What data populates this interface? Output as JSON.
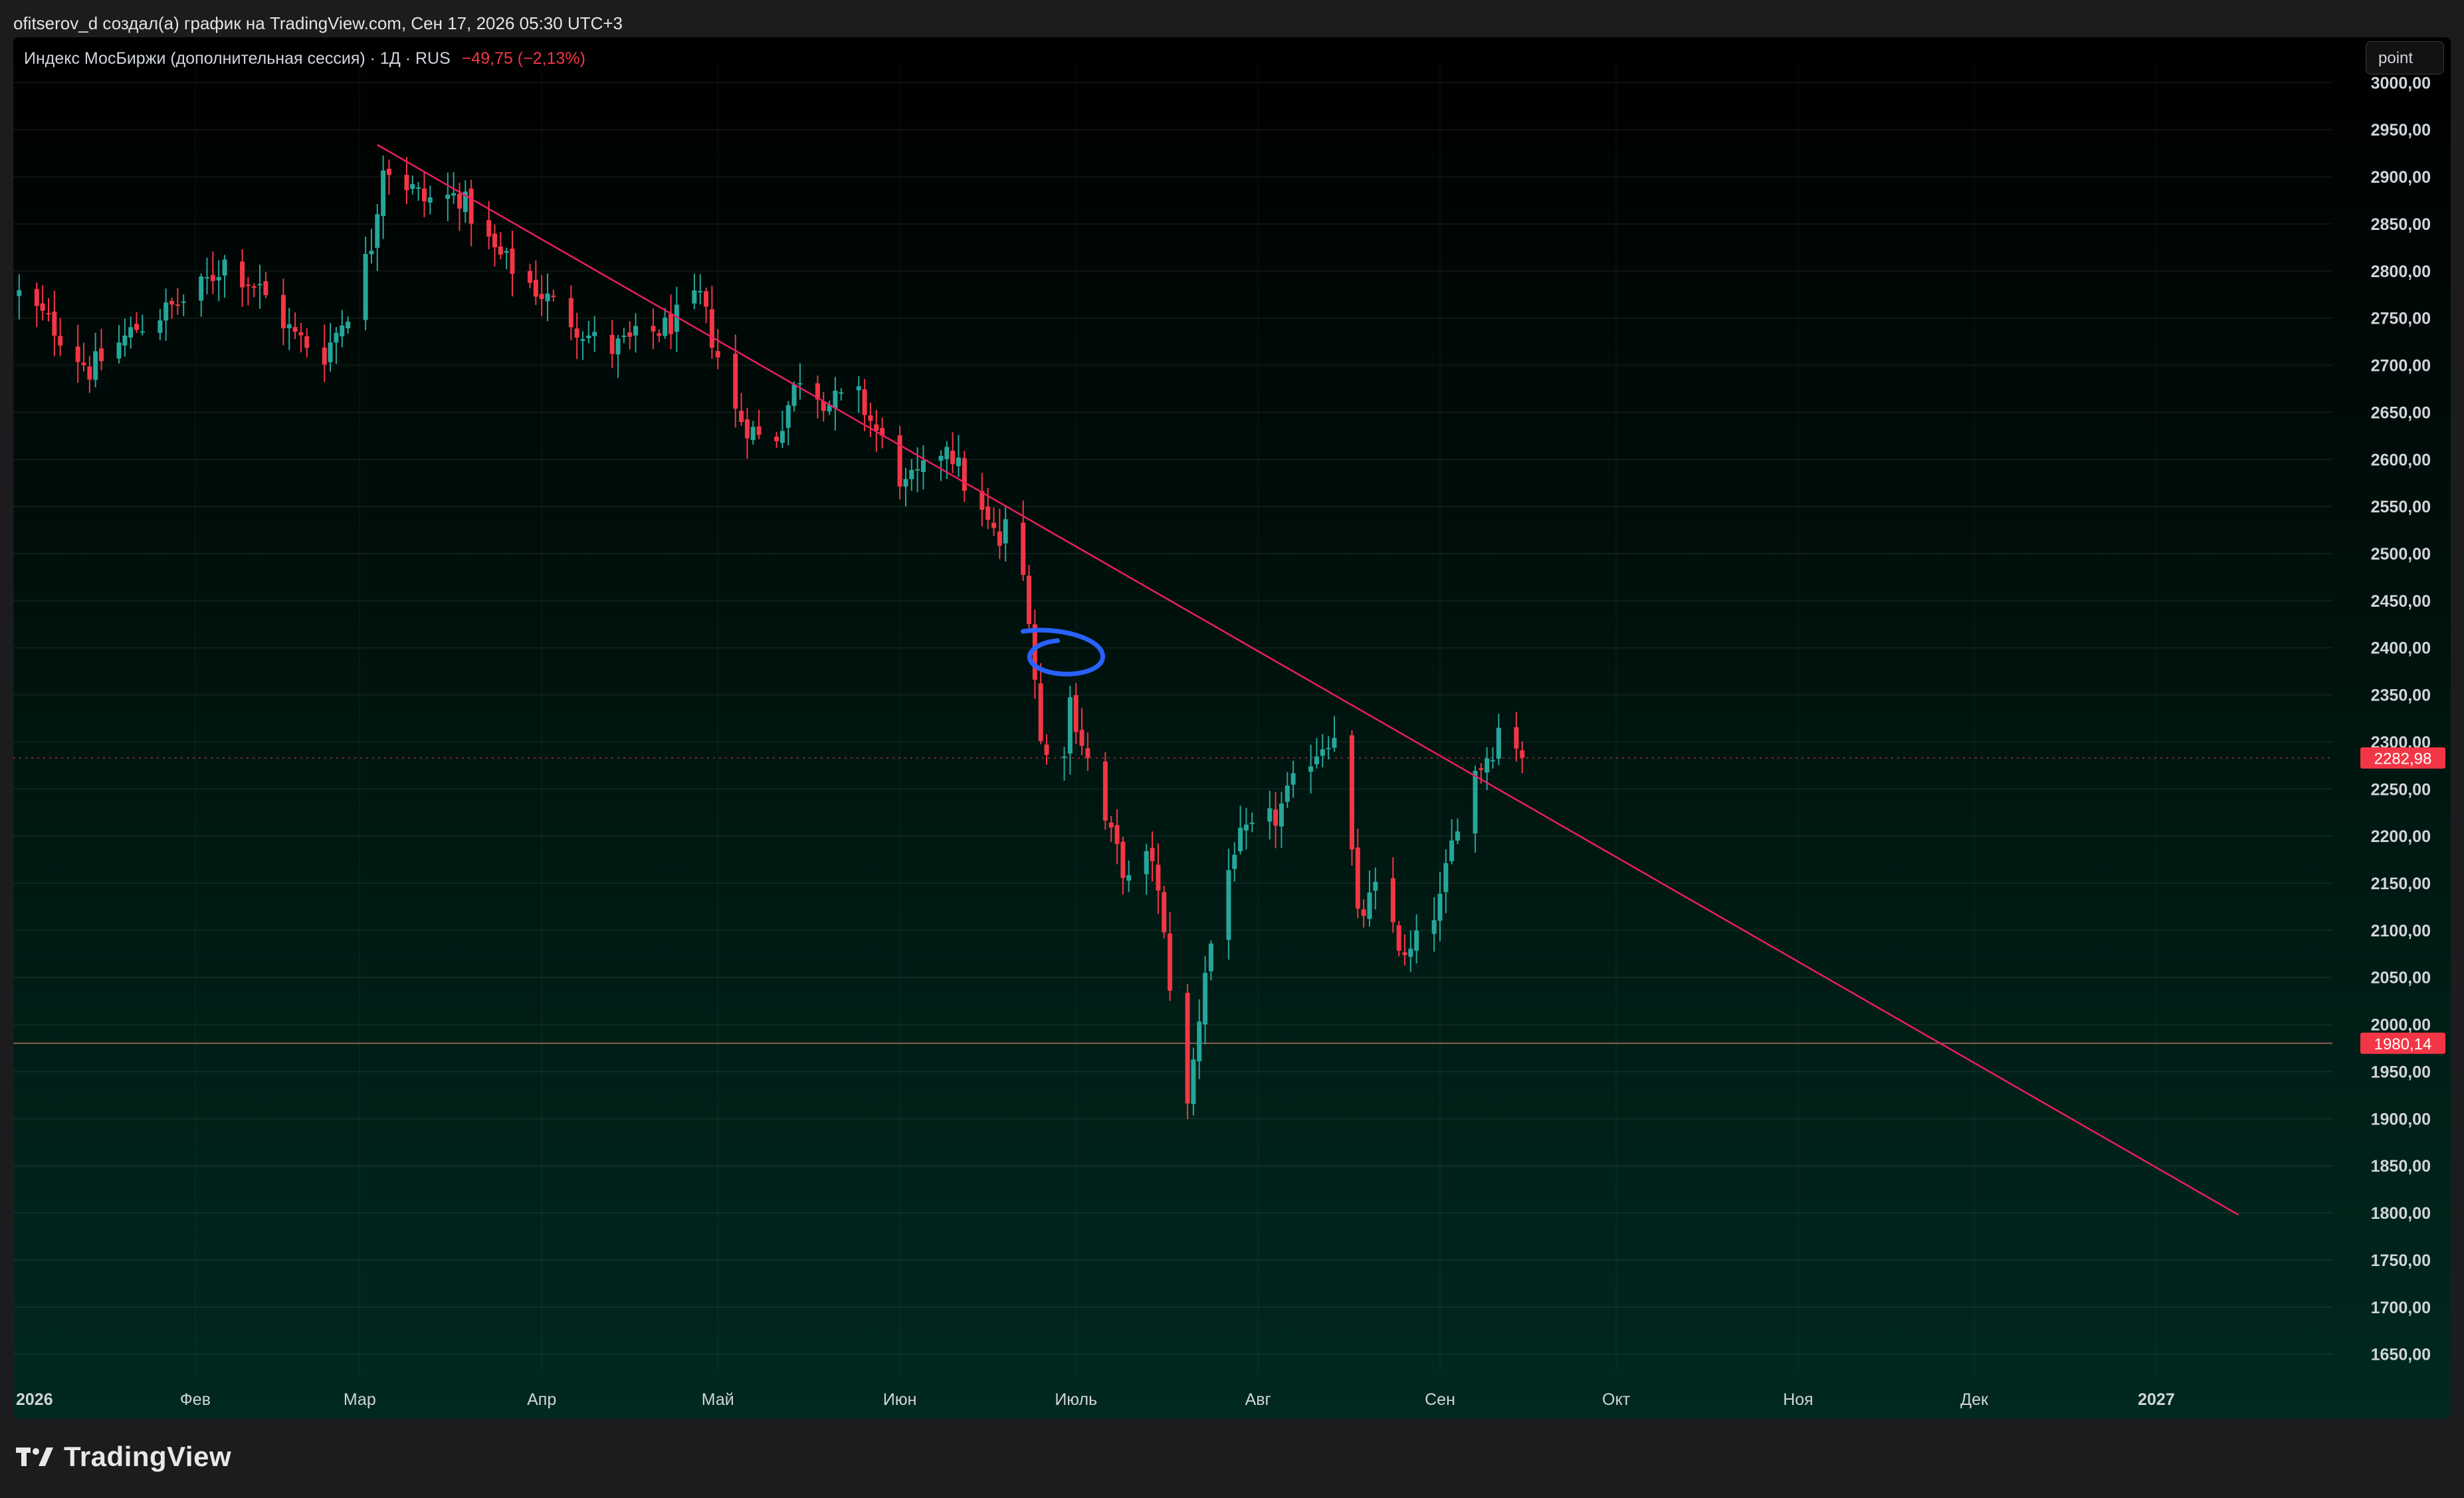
{
  "header": {
    "caption": "ofitserov_d создал(а) график на TradingView.com, Сен 17, 2026 05:30 UTC+3"
  },
  "legend": {
    "symbol_text": "Индекс МосБиржи (дополнительная сессия) · 1Д · RUS",
    "change_text": "−49,75 (−2,13%)"
  },
  "toolbar": {
    "point_label": "point"
  },
  "footer": {
    "brand": "TradingView"
  },
  "colors": {
    "up": "#26a69a",
    "down": "#f23645",
    "trendline": "#e91e63",
    "annotation": "#2962ff",
    "price_badge": "#f23645"
  },
  "chart_data": {
    "type": "candlestick",
    "title": "Индекс МосБиржи (дополнительная сессия)",
    "interval": "1Д",
    "exchange": "RUS",
    "x_tick_labels": [
      "2026",
      "Фев",
      "Мар",
      "Апр",
      "Май",
      "Июн",
      "Июль",
      "Авг",
      "Сен",
      "Окт",
      "Ноя",
      "Дек",
      "2027"
    ],
    "x_range": [
      "2026-01-01",
      "2027-01-31"
    ],
    "y_tick_labels": [
      "3000,00",
      "2950,00",
      "2900,00",
      "2850,00",
      "2800,00",
      "2750,00",
      "2700,00",
      "2650,00",
      "2600,00",
      "2550,00",
      "2500,00",
      "2450,00",
      "2400,00",
      "2350,00",
      "2300,00",
      "2250,00",
      "2200,00",
      "2150,00",
      "2100,00",
      "2050,00",
      "2000,00",
      "1950,00",
      "1900,00",
      "1850,00",
      "1800,00",
      "1750,00",
      "1700,00",
      "1650,00"
    ],
    "ylim": [
      1630,
      3020
    ],
    "price_levels": [
      {
        "label": "2282,98",
        "value": 2282.98,
        "style": "dotted"
      },
      {
        "label": "1980,14",
        "value": 1980.14,
        "style": "solid"
      }
    ],
    "trendline": {
      "start": {
        "date": "2026-03-04",
        "value": 2934
      },
      "end": {
        "date": "2027-01-15",
        "value": 1798
      }
    },
    "annotation_ellipse": {
      "date": "2026-06-29",
      "value": 2392
    },
    "anchors": [
      {
        "date": "2026-01-02",
        "value": 2775
      },
      {
        "date": "2026-01-08",
        "value": 2740
      },
      {
        "date": "2026-01-14",
        "value": 2695
      },
      {
        "date": "2026-01-22",
        "value": 2740
      },
      {
        "date": "2026-02-01",
        "value": 2775
      },
      {
        "date": "2026-02-06",
        "value": 2810
      },
      {
        "date": "2026-02-12",
        "value": 2780
      },
      {
        "date": "2026-02-18",
        "value": 2730
      },
      {
        "date": "2026-02-23",
        "value": 2712
      },
      {
        "date": "2026-02-28",
        "value": 2770
      },
      {
        "date": "2026-03-03",
        "value": 2830
      },
      {
        "date": "2026-03-05",
        "value": 2915
      },
      {
        "date": "2026-03-12",
        "value": 2875
      },
      {
        "date": "2026-03-18",
        "value": 2880
      },
      {
        "date": "2026-03-24",
        "value": 2820
      },
      {
        "date": "2026-04-02",
        "value": 2770
      },
      {
        "date": "2026-04-12",
        "value": 2715
      },
      {
        "date": "2026-04-22",
        "value": 2740
      },
      {
        "date": "2026-04-28",
        "value": 2770
      },
      {
        "date": "2026-05-04",
        "value": 2650
      },
      {
        "date": "2026-05-10",
        "value": 2610
      },
      {
        "date": "2026-05-15",
        "value": 2690
      },
      {
        "date": "2026-05-20",
        "value": 2660
      },
      {
        "date": "2026-05-25",
        "value": 2665
      },
      {
        "date": "2026-06-02",
        "value": 2570
      },
      {
        "date": "2026-06-06",
        "value": 2590
      },
      {
        "date": "2026-06-09",
        "value": 2620
      },
      {
        "date": "2026-06-13",
        "value": 2560
      },
      {
        "date": "2026-06-18",
        "value": 2510
      },
      {
        "date": "2026-06-20",
        "value": 2545
      },
      {
        "date": "2026-06-23",
        "value": 2440
      },
      {
        "date": "2026-06-25",
        "value": 2300
      },
      {
        "date": "2026-06-28",
        "value": 2250
      },
      {
        "date": "2026-06-30",
        "value": 2345
      },
      {
        "date": "2026-07-06",
        "value": 2215
      },
      {
        "date": "2026-07-10",
        "value": 2150
      },
      {
        "date": "2026-07-14",
        "value": 2180
      },
      {
        "date": "2026-07-18",
        "value": 2000
      },
      {
        "date": "2026-07-20",
        "value": 1910
      },
      {
        "date": "2026-07-23",
        "value": 2060
      },
      {
        "date": "2026-07-28",
        "value": 2190
      },
      {
        "date": "2026-08-04",
        "value": 2220
      },
      {
        "date": "2026-08-10",
        "value": 2285
      },
      {
        "date": "2026-08-15",
        "value": 2320
      },
      {
        "date": "2026-08-18",
        "value": 2110
      },
      {
        "date": "2026-08-22",
        "value": 2150
      },
      {
        "date": "2026-08-26",
        "value": 2065
      },
      {
        "date": "2026-09-01",
        "value": 2130
      },
      {
        "date": "2026-09-05",
        "value": 2250
      },
      {
        "date": "2026-09-10",
        "value": 2295
      },
      {
        "date": "2026-09-12",
        "value": 2335
      },
      {
        "date": "2026-09-15",
        "value": 2283
      }
    ],
    "grid": true,
    "legend_position": "top-left"
  }
}
